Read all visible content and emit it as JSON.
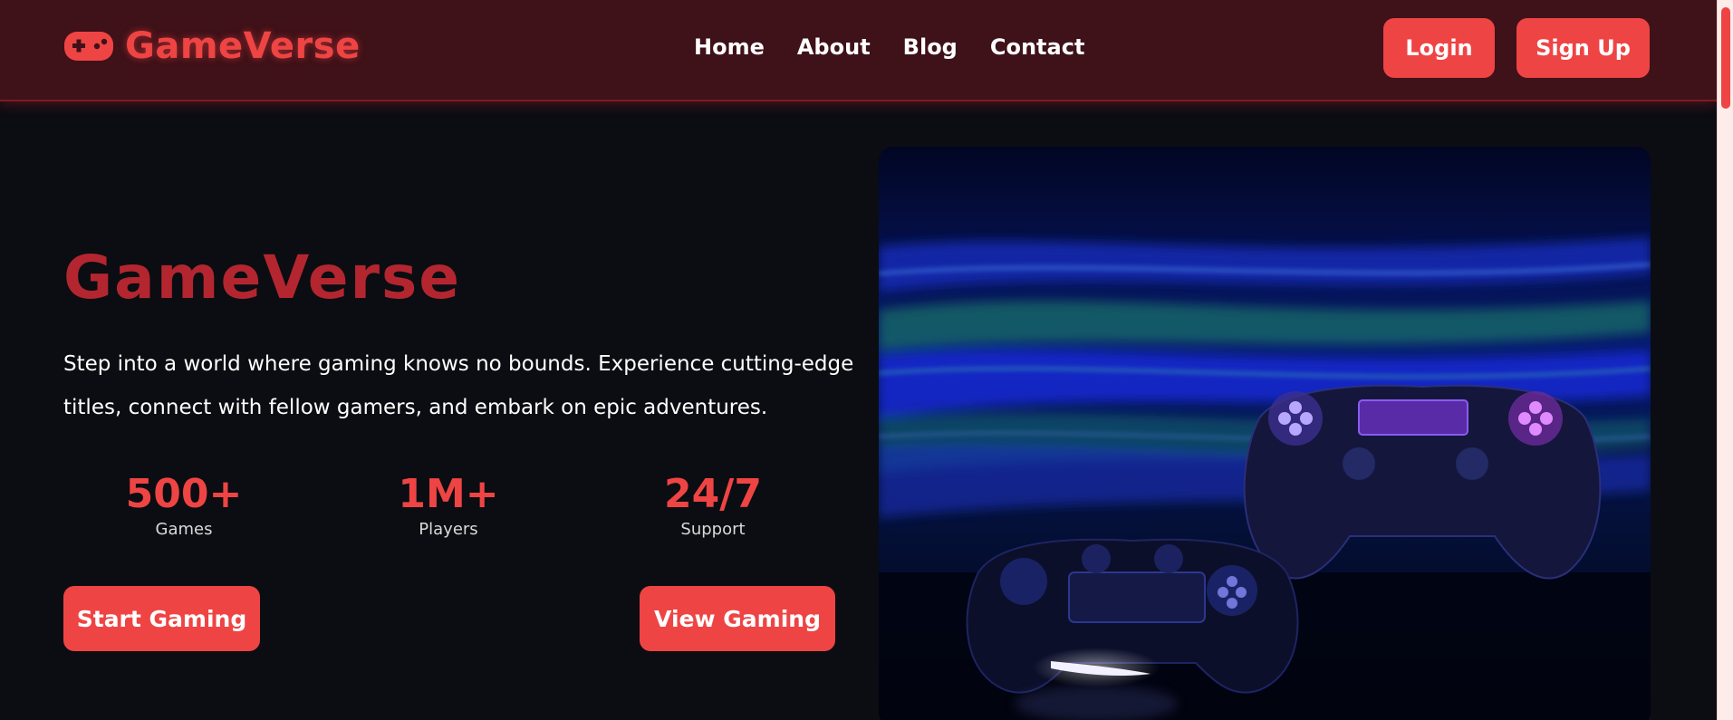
{
  "brand": {
    "name": "GameVerse",
    "icon": "gamepad-icon",
    "color": "#ef4444"
  },
  "nav": {
    "items": [
      {
        "label": "Home"
      },
      {
        "label": "About"
      },
      {
        "label": "Blog"
      },
      {
        "label": "Contact"
      }
    ]
  },
  "auth": {
    "login_label": "Login",
    "signup_label": "Sign Up"
  },
  "hero": {
    "title": "GameVerse",
    "description": "Step into a world where gaming knows no bounds. Experience cutting-edge titles, connect with fellow gamers, and embark on epic adventures.",
    "stats": [
      {
        "value": "500+",
        "label": "Games"
      },
      {
        "value": "1M+",
        "label": "Players"
      },
      {
        "value": "24/7",
        "label": "Support"
      }
    ],
    "primary_cta": "Start Gaming",
    "secondary_cta": "View Gaming",
    "image_subject": "game-controllers-photo"
  },
  "colors": {
    "header_bg": "#3f1118",
    "page_bg": "#0b0d12",
    "accent": "#ef4444",
    "title": "#b3262f"
  }
}
